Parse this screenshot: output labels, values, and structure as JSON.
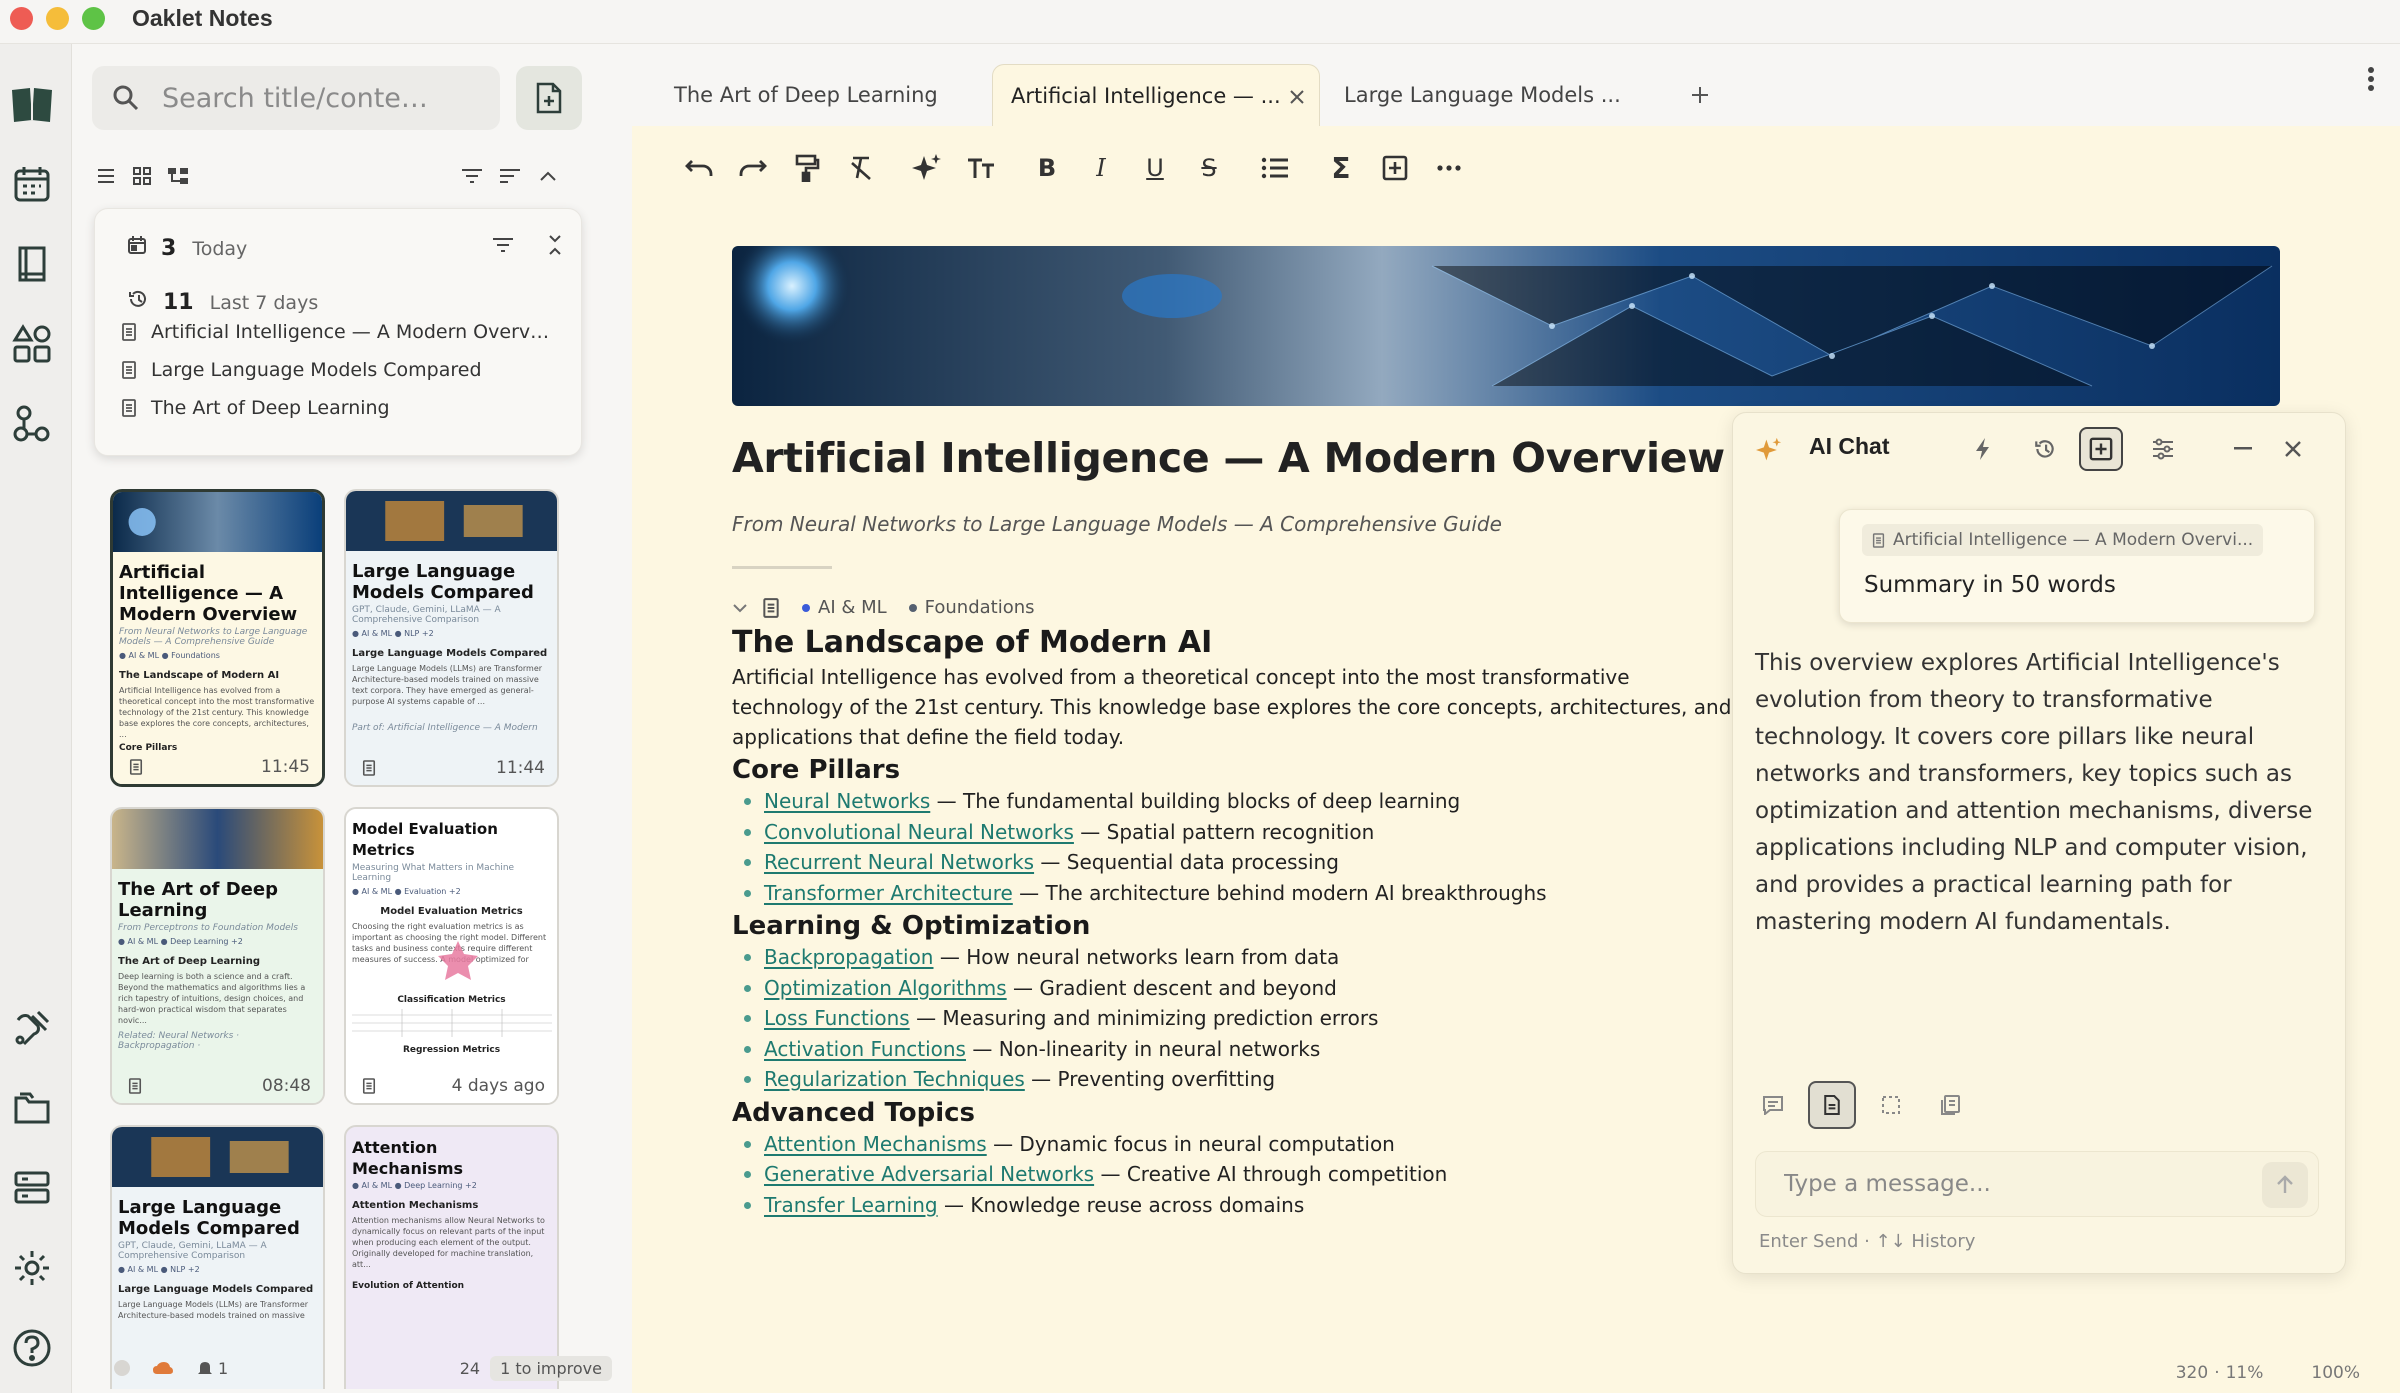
{
  "app": {
    "title": "Oaklet Notes"
  },
  "sidebar": {
    "search_placeholder": "Search title/conte…",
    "recent": {
      "today_count": "3",
      "today_label": "Today",
      "week_count": "11",
      "week_label": "Last 7 days",
      "items": [
        {
          "label": "Artificial Intelligence — A Modern Overv…"
        },
        {
          "label": "Large Language Models Compared"
        },
        {
          "label": "The Art of Deep Learning"
        }
      ]
    },
    "cards": [
      {
        "title": "Artificial Intelligence — A Modern Overview",
        "sub": "From Neural Networks to Large Language Models — A Comprehensive Guide",
        "tags": "● AI & ML  ● Foundations",
        "heading": "The Landscape of Modern AI",
        "body": "Artificial Intelligence has evolved from a theoretical concept into the most transformative technology of the 21st century. This knowledge base explores the core concepts, architectures, ...",
        "extra": "Core Pillars",
        "time": "11:45"
      },
      {
        "title": "Large Language Models Compared",
        "sub": "GPT, Claude, Gemini, LLaMA — A Comprehensive Comparison",
        "tags": "● AI & ML  ● NLP  +2",
        "heading": "Large Language Models Compared",
        "body": "Large Language Models (LLMs) are Transformer Architecture-based models trained on massive text corpora. They have emerged as general-purpose AI systems capable of ...",
        "extra": "Part of: Artificial Intelligence — A Modern",
        "time": "11:44"
      },
      {
        "title": "The Art of Deep Learning",
        "sub": "From Perceptrons to Foundation Models",
        "tags": "● AI & ML  ● Deep Learning  +2",
        "heading": "The Art of Deep Learning",
        "body": "Deep learning is both a science and a craft. Beyond the mathematics and algorithms lies a rich tapestry of intuitions, design choices, and hard-won practical wisdom that separates novic...",
        "extra": "Related: Neural Networks · Backpropagation ·",
        "time": "08:48"
      },
      {
        "title": "Model Evaluation Metrics",
        "sub": "Measuring What Matters in Machine Learning",
        "tags": "● AI & ML  ● Evaluation  +2",
        "heading": "Model Evaluation Metrics",
        "body": "Choosing the right evaluation metrics is as important as choosing the right model. Different tasks and business contexts require different measures of success. A model optimized for the...",
        "extra": "Classification Metrics",
        "extra2": "Regression Metrics",
        "time": "4 days ago"
      },
      {
        "title": "Large Language Models Compared",
        "sub": "GPT, Claude, Gemini, LLaMA — A Comprehensive Comparison",
        "tags": "● AI & ML  ● NLP  +2",
        "heading": "Large Language Models Compared",
        "body": "Large Language Models (LLMs) are Transformer Architecture-based models trained on massive",
        "time": ""
      },
      {
        "title": "Attention Mechanisms",
        "sub": "",
        "tags": "● AI & ML  ● Deep Learning  +2",
        "heading": "Attention Mechanisms",
        "body": "Attention mechanisms allow Neural Networks to dynamically focus on relevant parts of the input when producing each element of the output. Originally developed for machine translation, att...",
        "extra": "Evolution of Attention",
        "time": ""
      }
    ],
    "footer": {
      "alerts": "1",
      "count": "24",
      "improve": "1 to improve"
    }
  },
  "tabs": [
    {
      "label": "The Art of Deep Learning"
    },
    {
      "label": "Artificial Intelligence — ..."
    },
    {
      "label": "Large Language Models ..."
    }
  ],
  "doc": {
    "title": "Artificial Intelligence — A Modern Overview",
    "subtitle": "From Neural Networks to Large Language Models — A Comprehensive Guide",
    "tags": [
      {
        "label": "AI & ML",
        "color": "#3a5bd9"
      },
      {
        "label": "Foundations",
        "color": "#556070"
      }
    ],
    "h_landscape": "The Landscape of Modern AI",
    "intro": "Artificial Intelligence has evolved from a theoretical concept into the most transformative technology of the 21st century. This knowledge base explores the core concepts, architectures, and applications that define the field today.",
    "sections": [
      {
        "heading": "Core Pillars",
        "items": [
          {
            "link": "Neural Networks",
            "desc": " — The fundamental building blocks of deep learning"
          },
          {
            "link": "Convolutional Neural Networks",
            "desc": " — Spatial pattern recognition"
          },
          {
            "link": "Recurrent Neural Networks",
            "desc": " — Sequential data processing"
          },
          {
            "link": "Transformer Architecture",
            "desc": " — The architecture behind modern AI breakthroughs"
          }
        ]
      },
      {
        "heading": "Learning & Optimization",
        "items": [
          {
            "link": "Backpropagation",
            "desc": " — How neural networks learn from data"
          },
          {
            "link": "Optimization Algorithms",
            "desc": " — Gradient descent and beyond"
          },
          {
            "link": "Loss Functions",
            "desc": " — Measuring and minimizing prediction errors"
          },
          {
            "link": "Activation Functions",
            "desc": " — Non-linearity in neural networks"
          },
          {
            "link": "Regularization Techniques",
            "desc": " — Preventing overfitting"
          }
        ]
      },
      {
        "heading": "Advanced Topics",
        "items": [
          {
            "link": "Attention Mechanisms",
            "desc": " — Dynamic focus in neural computation"
          },
          {
            "link": "Generative Adversarial Networks",
            "desc": " — Creative AI through competition"
          },
          {
            "link": "Transfer Learning",
            "desc": " — Knowledge reuse across domains"
          }
        ]
      }
    ]
  },
  "chat": {
    "title": "AI Chat",
    "context": "Artificial Intelligence — A Modern Overvi...",
    "question": "Summary in 50 words",
    "answer": "This overview explores Artificial Intelligence's evolution from theory to transformative technology. It covers core pillars like neural networks and transformers, key topics such as optimization and attention mechanisms, diverse applications including NLP and computer vision, and provides a practical learning path for mastering modern AI fundamentals.",
    "input_placeholder": "Type a message...",
    "hint": "Enter Send · ↑↓ History"
  },
  "status": {
    "words": "320",
    "progress": "11%",
    "zoom": "100%"
  }
}
